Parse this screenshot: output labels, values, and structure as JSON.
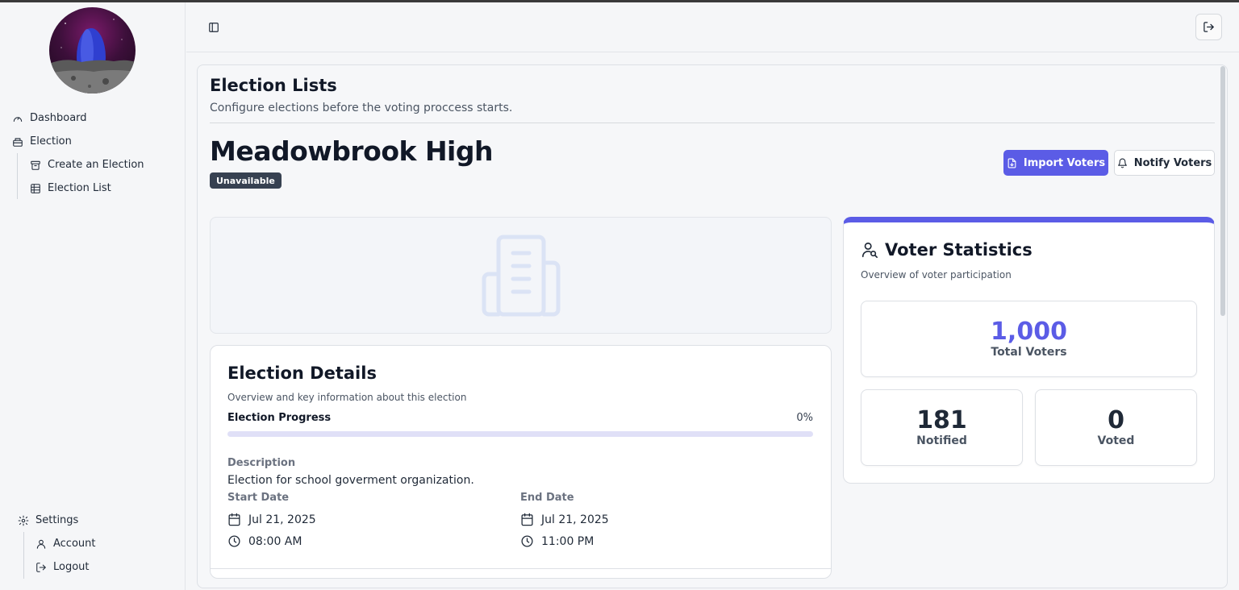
{
  "sidebar": {
    "nav": [
      {
        "label": "Dashboard",
        "icon": "gauge-icon"
      },
      {
        "label": "Election",
        "icon": "ballot-box-icon"
      }
    ],
    "election_sub": [
      {
        "label": "Create an Election",
        "icon": "archive-icon"
      },
      {
        "label": "Election List",
        "icon": "table-icon"
      }
    ],
    "settings": {
      "label": "Settings",
      "icon": "gear-icon"
    },
    "settings_sub": [
      {
        "label": "Account",
        "icon": "user-icon"
      },
      {
        "label": "Logout",
        "icon": "logout-icon"
      }
    ]
  },
  "page": {
    "title": "Election Lists",
    "subtitle": "Configure elections before the voting proccess starts."
  },
  "election": {
    "name": "Meadowbrook High",
    "status": "Unavailable",
    "import_label": "Import Voters",
    "notify_label": "Notify Voters"
  },
  "details": {
    "title": "Election Details",
    "subtitle": "Overview and key information about this election",
    "progress_label": "Election Progress",
    "progress_text": "0%",
    "progress_value": 0,
    "description_label": "Description",
    "description": "Election for school goverment organization.",
    "start_label": "Start Date",
    "start_date": "Jul 21, 2025",
    "start_time": "08:00 AM",
    "end_label": "End Date",
    "end_date": "Jul 21, 2025",
    "end_time": "11:00 PM"
  },
  "stats": {
    "title": "Voter Statistics",
    "subtitle": "Overview of voter participation",
    "total_value": "1,000",
    "total_label": "Total Voters",
    "notified_value": "181",
    "notified_label": "Notified",
    "voted_value": "0",
    "voted_label": "Voted"
  },
  "colors": {
    "accent": "#5b5ce6",
    "badge_bg": "#374151"
  }
}
